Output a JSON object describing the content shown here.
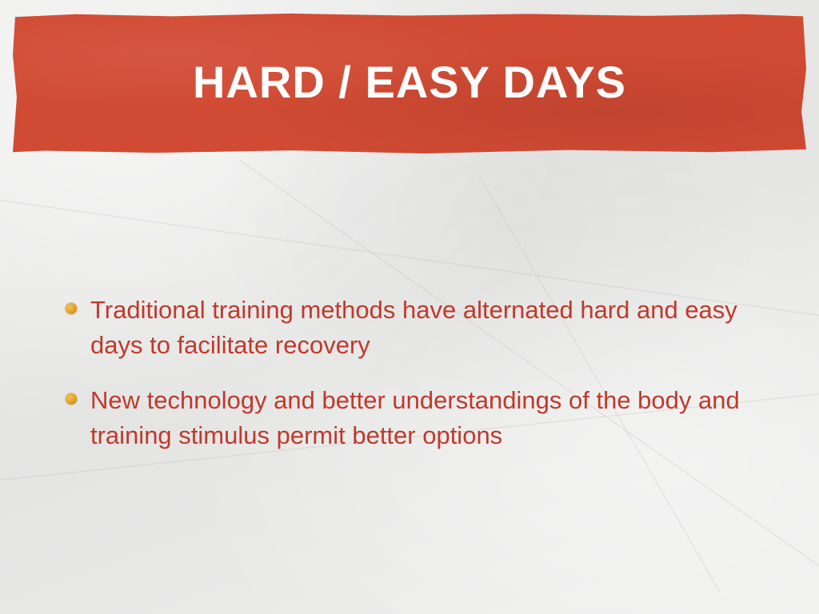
{
  "slide": {
    "title": "HARD / EASY DAYS",
    "bullets": [
      {
        "text": "Traditional training methods have alternated hard and easy days to facilitate recovery"
      },
      {
        "text": "New technology and better understandings of the body and training stimulus permit better options"
      }
    ]
  },
  "colors": {
    "banner": "#d14a33",
    "title_text": "#ffffff",
    "bullet_text": "#c0392b",
    "bullet_marker": "#e0a22a",
    "background": "#e9e9e8"
  }
}
